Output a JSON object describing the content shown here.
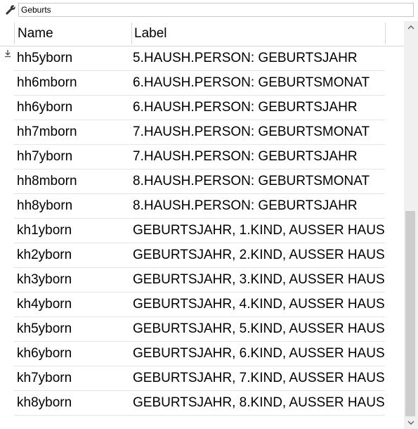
{
  "filter": {
    "value": "Geburts",
    "icon": "wrench-icon"
  },
  "table": {
    "columns": [
      "Name",
      "Label"
    ],
    "rows": [
      {
        "name": "hh5yborn",
        "label": "5.HAUSH.PERSON: GEBURTSJAHR"
      },
      {
        "name": "hh6mborn",
        "label": "6.HAUSH.PERSON: GEBURTSMONAT"
      },
      {
        "name": "hh6yborn",
        "label": "6.HAUSH.PERSON: GEBURTSJAHR"
      },
      {
        "name": "hh7mborn",
        "label": "7.HAUSH.PERSON: GEBURTSMONAT"
      },
      {
        "name": "hh7yborn",
        "label": "7.HAUSH.PERSON: GEBURTSJAHR"
      },
      {
        "name": "hh8mborn",
        "label": "8.HAUSH.PERSON: GEBURTSMONAT"
      },
      {
        "name": "hh8yborn",
        "label": "8.HAUSH.PERSON: GEBURTSJAHR"
      },
      {
        "name": "kh1yborn",
        "label": "GEBURTSJAHR, 1.KIND, AUSSER HAUS"
      },
      {
        "name": "kh2yborn",
        "label": "GEBURTSJAHR, 2.KIND, AUSSER HAUS"
      },
      {
        "name": "kh3yborn",
        "label": "GEBURTSJAHR, 3.KIND, AUSSER HAUS"
      },
      {
        "name": "kh4yborn",
        "label": "GEBURTSJAHR, 4.KIND, AUSSER HAUS"
      },
      {
        "name": "kh5yborn",
        "label": "GEBURTSJAHR, 5.KIND, AUSSER HAUS"
      },
      {
        "name": "kh6yborn",
        "label": "GEBURTSJAHR, 6.KIND, AUSSER HAUS"
      },
      {
        "name": "kh7yborn",
        "label": "GEBURTSJAHR, 7.KIND, AUSSER HAUS"
      },
      {
        "name": "kh8yborn",
        "label": "GEBURTSJAHR, 8.KIND, AUSSER HAUS"
      }
    ]
  },
  "scrollbar": {
    "up_icon": "scroll-up-arrow-icon",
    "down_icon": "scroll-down-arrow-icon"
  }
}
